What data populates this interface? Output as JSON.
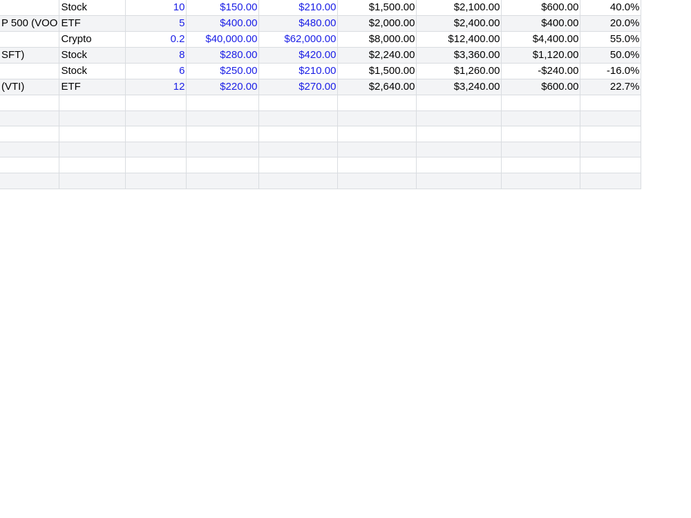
{
  "table": {
    "rows": [
      {
        "name": "",
        "type": "Stock",
        "qty": "10",
        "buy": "$150.00",
        "current": "$210.00",
        "cost": "$1,500.00",
        "value": "$2,100.00",
        "gain": "$600.00",
        "pct": "40.0%"
      },
      {
        "name": "P 500 (VOO",
        "type": "ETF",
        "qty": "5",
        "buy": "$400.00",
        "current": "$480.00",
        "cost": "$2,000.00",
        "value": "$2,400.00",
        "gain": "$400.00",
        "pct": "20.0%"
      },
      {
        "name": "",
        "type": "Crypto",
        "qty": "0.2",
        "buy": "$40,000.00",
        "current": "$62,000.00",
        "cost": "$8,000.00",
        "value": "$12,400.00",
        "gain": "$4,400.00",
        "pct": "55.0%"
      },
      {
        "name": "SFT)",
        "type": "Stock",
        "qty": "8",
        "buy": "$280.00",
        "current": "$420.00",
        "cost": "$2,240.00",
        "value": "$3,360.00",
        "gain": "$1,120.00",
        "pct": "50.0%"
      },
      {
        "name": "",
        "type": "Stock",
        "qty": "6",
        "buy": "$250.00",
        "current": "$210.00",
        "cost": "$1,500.00",
        "value": "$1,260.00",
        "gain": "-$240.00",
        "pct": "-16.0%"
      },
      {
        "name": "(VTI)",
        "type": "ETF",
        "qty": "12",
        "buy": "$220.00",
        "current": "$270.00",
        "cost": "$2,640.00",
        "value": "$3,240.00",
        "gain": "$600.00",
        "pct": "22.7%"
      }
    ]
  },
  "colors": {
    "input_text": "#1a1ee6",
    "grid_line": "#d9dce0",
    "alt_row": "#f3f4f6"
  }
}
